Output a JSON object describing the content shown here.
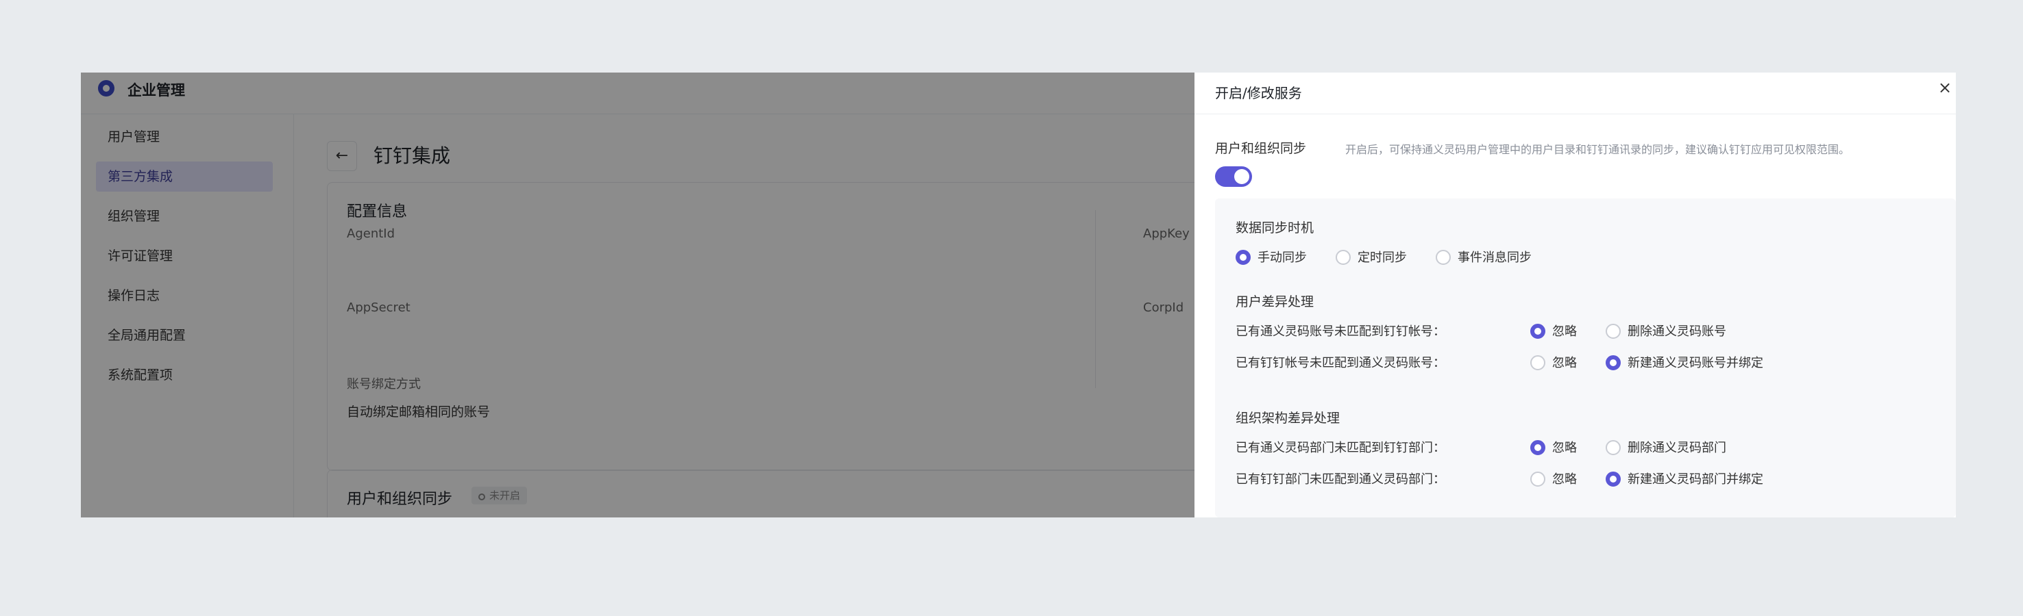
{
  "header": {
    "title": "企业管理",
    "logo_icon": "logo-icon"
  },
  "sidebar": {
    "items": [
      {
        "label": "用户管理",
        "active": false
      },
      {
        "label": "第三方集成",
        "active": true
      },
      {
        "label": "组织管理",
        "active": false
      },
      {
        "label": "许可证管理",
        "active": false
      },
      {
        "label": "操作日志",
        "active": false
      },
      {
        "label": "全局通用配置",
        "active": false
      },
      {
        "label": "系统配置项",
        "active": false
      }
    ]
  },
  "main": {
    "back_icon": "←",
    "title": "钉钉集成",
    "config": {
      "title": "配置信息",
      "agentid_label": "AgentId",
      "appkey_label": "AppKey",
      "appsecret_label": "AppSecret",
      "corpid_label": "CorpId",
      "binding_label": "账号绑定方式",
      "binding_value": "自动绑定邮箱相同的账号"
    },
    "sync_card": {
      "title": "用户和组织同步",
      "status_badge": "未开启"
    }
  },
  "drawer": {
    "title": "开启/修改服务",
    "close_icon": "×",
    "sync_label": "用户和组织同步",
    "sync_desc": "开启后，可保持通义灵码用户管理中的用户目录和钉钉通讯录的同步，建议确认钉钉应用可见权限范围。",
    "sync_enabled": true,
    "timing": {
      "title": "数据同步时机",
      "options": [
        "手动同步",
        "定时同步",
        "事件消息同步"
      ],
      "selected": "手动同步"
    },
    "user_diff": {
      "title": "用户差异处理",
      "rows": [
        {
          "label": "已有通义灵码账号未匹配到钉钉帐号：",
          "options": [
            "忽略",
            "删除通义灵码账号"
          ],
          "selected": "忽略"
        },
        {
          "label": "已有钉钉帐号未匹配到通义灵码账号：",
          "options": [
            "忽略",
            "新建通义灵码账号并绑定"
          ],
          "selected": "新建通义灵码账号并绑定"
        }
      ]
    },
    "org_diff": {
      "title": "组织架构差异处理",
      "rows": [
        {
          "label": "已有通义灵码部门未匹配到钉钉部门：",
          "options": [
            "忽略",
            "删除通义灵码部门"
          ],
          "selected": "忽略"
        },
        {
          "label": "已有钉钉部门未匹配到通义灵码部门：",
          "options": [
            "忽略",
            "新建通义灵码部门并绑定"
          ],
          "selected": "新建通义灵码部门并绑定"
        }
      ]
    }
  },
  "colors": {
    "accent": "#5b57d6",
    "sidebar_active_bg": "#e6e6ff",
    "page_bg": "#e8ebee"
  }
}
